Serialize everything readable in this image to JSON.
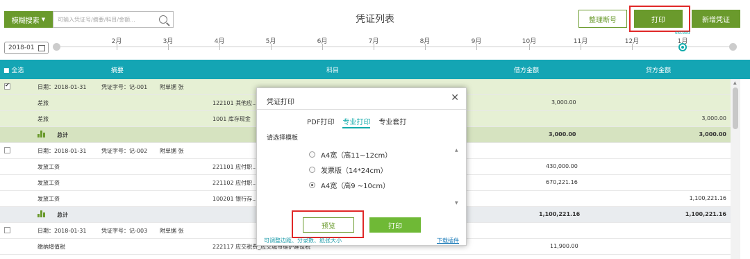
{
  "toolbar": {
    "fuzzy_search_label": "模糊搜索",
    "search_placeholder": "可输入凭证号/摘要/科目/金额...",
    "title": "凭证列表",
    "reorder_label": "整理断号",
    "print_label": "打印",
    "new_voucher_label": "新增凭证"
  },
  "timeline": {
    "year_value": "2018-01",
    "months": [
      "2月",
      "3月",
      "4月",
      "5月",
      "6月",
      "7月",
      "8月",
      "9月",
      "10月",
      "11月",
      "12月",
      "1月"
    ],
    "active_badge": "exceed",
    "accent_color": "#13a9b7"
  },
  "table": {
    "select_all_label": "全选",
    "headers": {
      "summary": "摘要",
      "account": "科目",
      "debit": "借方金额",
      "credit": "贷方金额"
    },
    "header_color": "#14a5b4",
    "total_label": "总计",
    "vouchers": [
      {
        "meta": {
          "date": "日期：2018-01-31",
          "number": "凭证字号：记-001",
          "attachments": "附单据  张"
        },
        "checked": true,
        "lines": [
          {
            "summary": "差旅",
            "account": "122101 其他应...",
            "debit": "3,000.00",
            "credit": ""
          },
          {
            "summary": "差旅",
            "account": "1001 库存现金",
            "debit": "",
            "credit": "3,000.00"
          }
        ],
        "total_debit": "3,000.00",
        "total_credit": "3,000.00"
      },
      {
        "meta": {
          "date": "日期：2018-01-31",
          "number": "凭证字号：记-002",
          "attachments": "附单据  张"
        },
        "checked": false,
        "lines": [
          {
            "summary": "发放工资",
            "account": "221101 应付职...",
            "debit": "430,000.00",
            "credit": ""
          },
          {
            "summary": "发放工资",
            "account": "221102 应付职...",
            "debit": "670,221.16",
            "credit": ""
          },
          {
            "summary": "发放工资",
            "account": "100201 银行存...",
            "debit": "",
            "credit": "1,100,221.16"
          }
        ],
        "total_debit": "1,100,221.16",
        "total_credit": "1,100,221.16"
      },
      {
        "meta": {
          "date": "日期：2018-01-31",
          "number": "凭证字号：记-003",
          "attachments": "附单据  张"
        },
        "checked": false,
        "lines": [
          {
            "summary": "缴纳增值税",
            "account": "222117 应交税费_应交城市维护建设税",
            "debit": "11,900.00",
            "credit": ""
          }
        ]
      }
    ]
  },
  "modal": {
    "title": "凭证打印",
    "tabs": [
      "PDF打印",
      "专业打印",
      "专业套打"
    ],
    "active_tab": "专业打印",
    "template_label": "请选择模板",
    "templates": [
      {
        "label": "A4宽（高11~12cm）",
        "selected": false
      },
      {
        "label": "发票版（14*24cm）",
        "selected": false
      },
      {
        "label": "A4宽（高9 ~10cm）",
        "selected": true
      }
    ],
    "preview_label": "预览",
    "print_label": "打印",
    "hint_text": "可调整边距、分录数、纸张大小",
    "download_label": "下载插件"
  },
  "colors": {
    "green": "#6a9a2c",
    "teal": "#14a5b4",
    "highlight_red": "#e02828"
  }
}
